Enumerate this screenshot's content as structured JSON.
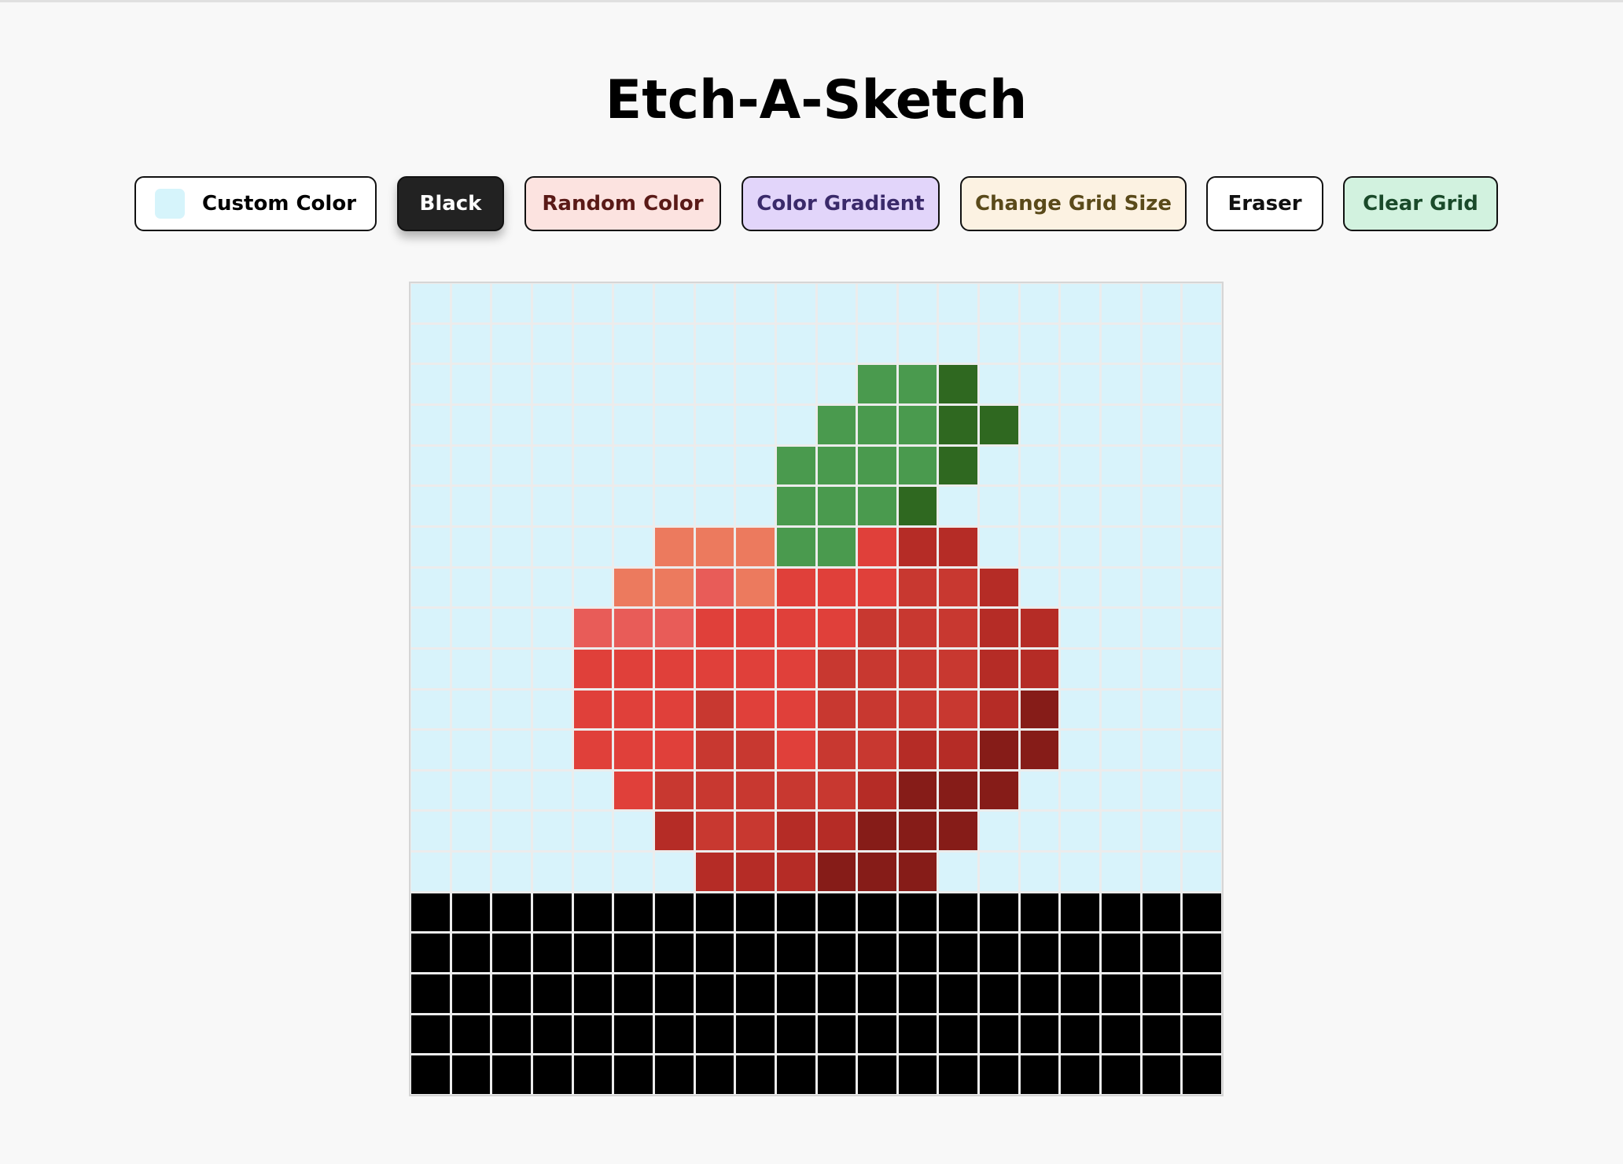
{
  "title": "Etch-A-Sketch",
  "toolbar": {
    "custom_color_label": "Custom Color",
    "black_label": "Black",
    "random_label": "Random Color",
    "gradient_label": "Color Gradient",
    "grid_size_label": "Change Grid Size",
    "eraser_label": "Eraser",
    "clear_label": "Clear Grid",
    "custom_color_value": "#d6f4fb"
  },
  "colors": {
    "palette": {
      "B": "#d8f3fb",
      "K": "#000000",
      "G": "#4a9a4e",
      "D": "#2f6820",
      "O": "#ec7a5e",
      "P": "#e85c58",
      "R": "#e0403a",
      "M": "#c83830",
      "N": "#b52c26",
      "X": "#861c18"
    }
  },
  "grid": {
    "size": 20,
    "rows": [
      "BBBBBBBBBBBBBBBBBBBB",
      "BBBBBBBBBBBBBBBBBBBB",
      "BBBBBBBBBBBGGDBBBBBB",
      "BBBBBBBBBBGGGDDBBBBB",
      "BBBBBBBBBGGGGDBBBBBB",
      "BBBBBBBBBGGGDBBBBBBB",
      "BBBBBBOOOGGRNNBBBBBB",
      "BBBBBOOPORRRMMNBBBBB",
      "BBBBPPPRRRRMMMNNBBBB",
      "BBBBRRRRRRMMMMNNBBBB",
      "BBBBRRRMRRMMMMNXBBBB",
      "BBBBRRRMMRMMNNXXBBBB",
      "BBBBBRMMMMMNXXXBBBBB",
      "BBBBBBNMMNNXXXBBBBBB",
      "BBBBBBBNNNXXXBBBBBBB",
      "KKKKKKKKKKKKKKKKKKKK",
      "KKKKKKKKKKKKKKKKKKKK",
      "KKKKKKKKKKKKKKKKKKKK",
      "KKKKKKKKKKKKKKKKKKKK",
      "KKKKKKKKKKKKKKKKKKKK"
    ]
  }
}
